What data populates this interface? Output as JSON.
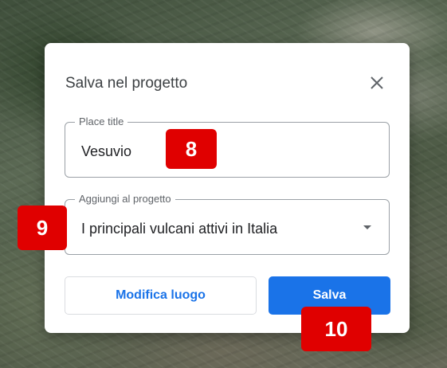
{
  "dialog": {
    "title": "Salva nel progetto",
    "close_icon": "close-icon"
  },
  "place_title_field": {
    "label": "Place title",
    "value": "Vesuvio"
  },
  "project_field": {
    "label": "Aggiungi al progetto",
    "value": "I principali vulcani attivi in Italia",
    "caret_icon": "caret-down-icon"
  },
  "buttons": {
    "edit_place": "Modifica luogo",
    "save": "Salva"
  },
  "markers": {
    "m8": "8",
    "m9": "9",
    "m10": "10"
  },
  "colors": {
    "accent": "#1a73e8",
    "marker": "#e00000"
  }
}
